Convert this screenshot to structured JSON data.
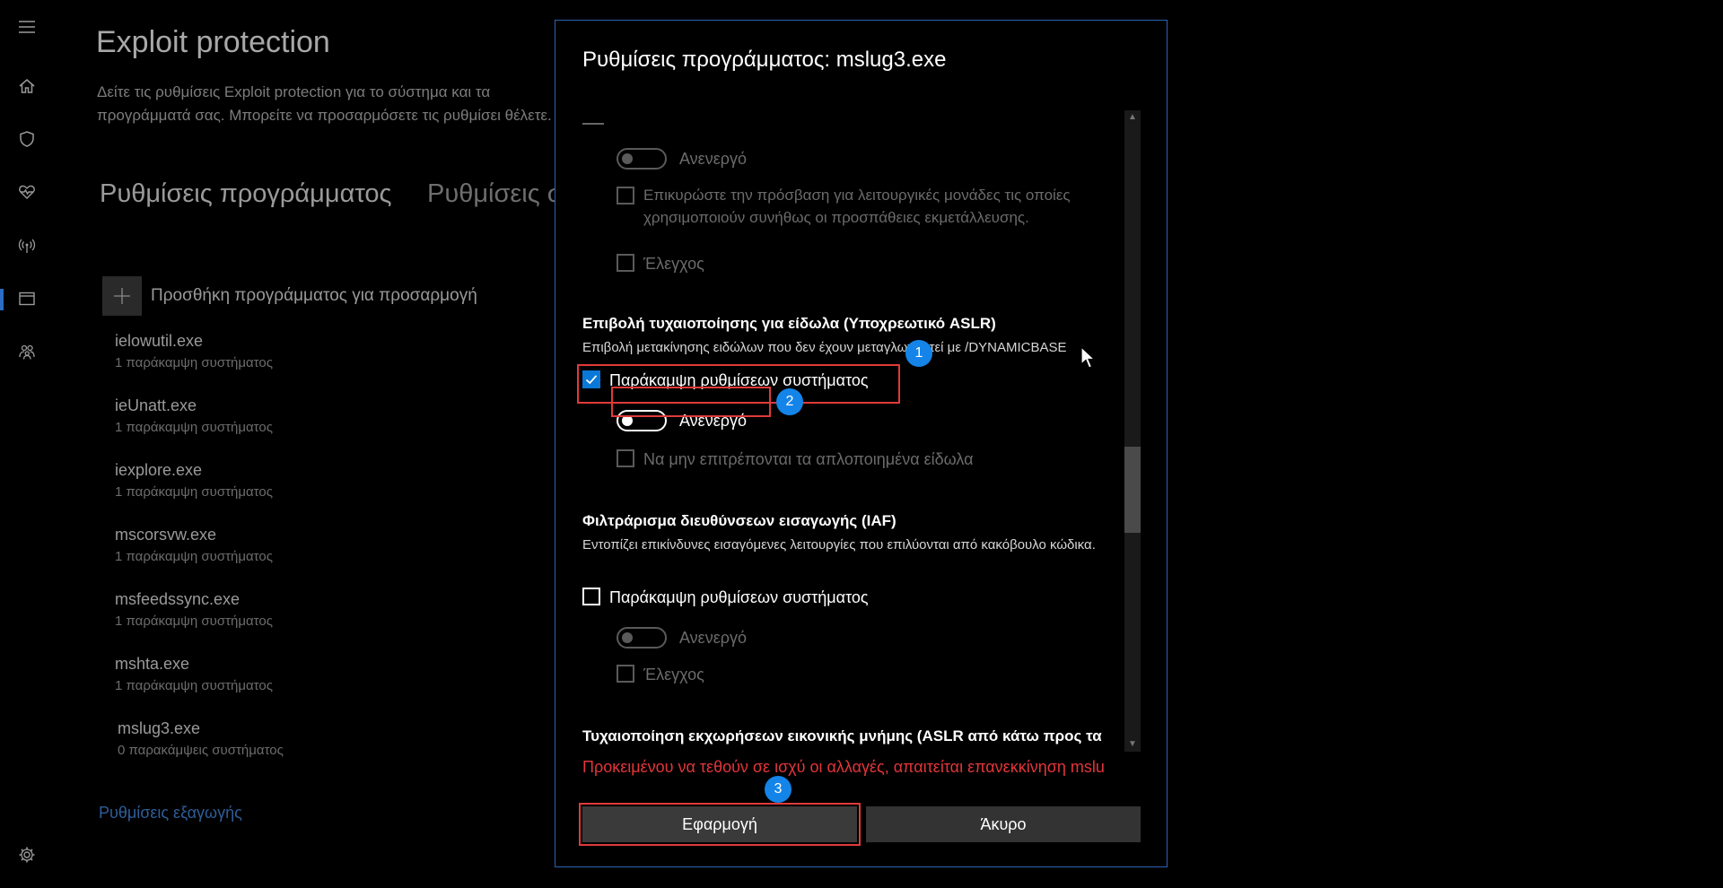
{
  "nav": {
    "icons": [
      "hamburger-icon",
      "home-icon",
      "shield-icon",
      "heart-icon",
      "wireless-icon",
      "app-browser-icon",
      "family-icon",
      "gear-icon"
    ]
  },
  "page": {
    "title": "Exploit protection",
    "description": "Δείτε τις ρυθμίσεις Exploit protection για το σύστημα και τα προγράμματά σας. Μπορείτε να προσαρμόσετε τις ρυθμίσει θέλετε.",
    "tabs": [
      "Ρυθμίσεις προγράμματος",
      "Ρυθμίσεις σ"
    ],
    "add_program": "Προσθήκη προγράμματος για προσαρμογή",
    "programs": [
      {
        "name": "ielowutil.exe",
        "sub": "1 παράκαμψη συστήματος"
      },
      {
        "name": "ieUnatt.exe",
        "sub": "1 παράκαμψη συστήματος"
      },
      {
        "name": "iexplore.exe",
        "sub": "1 παράκαμψη συστήματος"
      },
      {
        "name": "mscorsvw.exe",
        "sub": "1 παράκαμψη συστήματος"
      },
      {
        "name": "msfeedssync.exe",
        "sub": "1 παράκαμψη συστήματος"
      },
      {
        "name": "mshta.exe",
        "sub": "1 παράκαμψη συστήματος"
      },
      {
        "name": "mslug3.exe",
        "sub": "0 παρακάμψεις συστήματος"
      }
    ],
    "export": "Ρυθμίσεις εξαγωγής"
  },
  "dialog": {
    "title": "Ρυθμίσεις προγράμματος: mslug3.exe",
    "top": {
      "toggle_label": "Ανενεργό",
      "validate_label": "Επικυρώστε την πρόσβαση για λειτουργικές μονάδες τις οποίες χρησιμοποιούν συνήθως οι προσπάθειες εκμετάλλευσης.",
      "audit_label": "Έλεγχος"
    },
    "aslr": {
      "title": "Επιβολή τυχαιοποίησης για είδωλα (Υποχρεωτικό ASLR)",
      "desc": "Επιβολή μετακίνησης ειδώλων που δεν έχουν μεταγλωττιστεί με /DYNAMICBASE",
      "override_label": "Παράκαμψη ρυθμίσεων συστήματος",
      "toggle_label": "Ανενεργό",
      "stripped_label": "Να μην επιτρέπονται τα απλοποιημένα είδωλα"
    },
    "iaf": {
      "title": "Φιλτράρισμα διευθύνσεων εισαγωγής (IAF)",
      "desc": "Εντοπίζει επικίνδυνες εισαγόμενες λειτουργίες που επιλύονται από κακόβουλο κώδικα.",
      "override_label": "Παράκαμψη ρυθμίσεων συστήματος",
      "toggle_label": "Ανενεργό",
      "audit_label": "Έλεγχος"
    },
    "bottom_up": {
      "title": "Τυχαιοποίηση εκχωρήσεων εικονικής μνήμης (ASLR από κάτω προς τα"
    },
    "warning": "Προκειμένου να τεθούν σε ισχύ οι αλλαγές, απαιτείται επανεκκίνηση mslu",
    "apply": "Εφαρμογή",
    "cancel": "Άκυρο",
    "badges": [
      "1",
      "2",
      "3"
    ]
  },
  "colors": {
    "accent": "#0a78d7",
    "highlight": "#e03a3a",
    "badge": "#1484e8",
    "warning": "#e3353a"
  }
}
